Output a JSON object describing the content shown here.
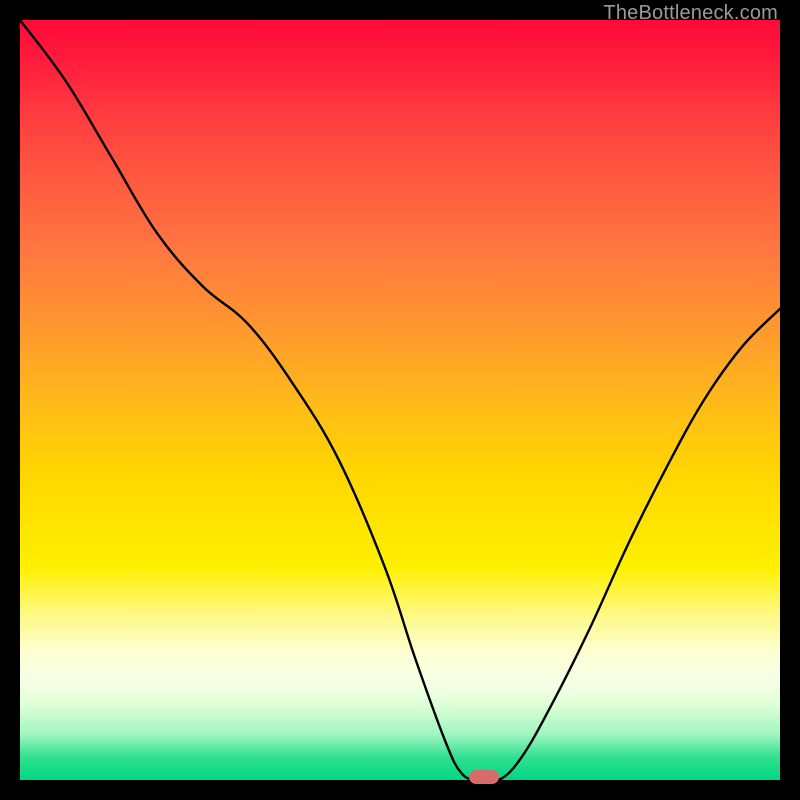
{
  "watermark": "TheBottleneck.com",
  "marker": {
    "enabled": true,
    "color": "#d86a6a"
  },
  "chart_data": {
    "type": "line",
    "title": "",
    "xlabel": "",
    "ylabel": "",
    "xlim": [
      0,
      100
    ],
    "ylim": [
      0,
      100
    ],
    "grid": false,
    "legend": false,
    "annotations": [],
    "series": [
      {
        "name": "bottleneck-curve",
        "x": [
          0,
          6,
          12,
          18,
          24,
          30,
          36,
          42,
          48,
          52,
          56,
          58,
          60,
          63,
          66,
          70,
          75,
          80,
          85,
          90,
          95,
          100
        ],
        "values": [
          100,
          92,
          82,
          72,
          65,
          60,
          52,
          42,
          28,
          16,
          5,
          1,
          0,
          0,
          3,
          10,
          20,
          31,
          41,
          50,
          57,
          62
        ]
      }
    ],
    "marker_point": {
      "x": 61,
      "value": 0
    }
  }
}
